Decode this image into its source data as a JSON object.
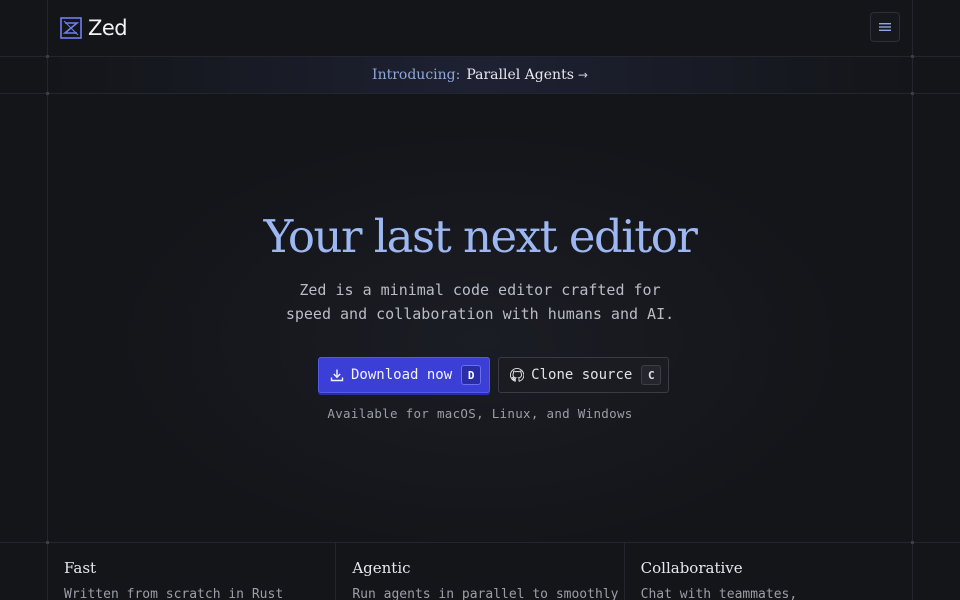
{
  "brand": {
    "name": "Zed",
    "accent": "#3b3fd6",
    "title_color": "#9cb7f2"
  },
  "header": {
    "menu_icon": "hamburger-menu-icon"
  },
  "announcement": {
    "prefix": "Introducing:",
    "link_label": "Parallel Agents",
    "arrow": "→"
  },
  "hero": {
    "title": "Your last next editor",
    "subtitle": "Zed is a minimal code editor crafted for speed and collaboration with humans and AI.",
    "download_label": "Download now",
    "download_key": "D",
    "clone_label": "Clone source",
    "clone_key": "C",
    "availability": "Available for macOS, Linux, and Windows"
  },
  "features": [
    {
      "title": "Fast",
      "desc": "Written from scratch in Rust"
    },
    {
      "title": "Agentic",
      "desc": "Run agents in parallel to smoothly"
    },
    {
      "title": "Collaborative",
      "desc": "Chat with teammates,"
    }
  ]
}
